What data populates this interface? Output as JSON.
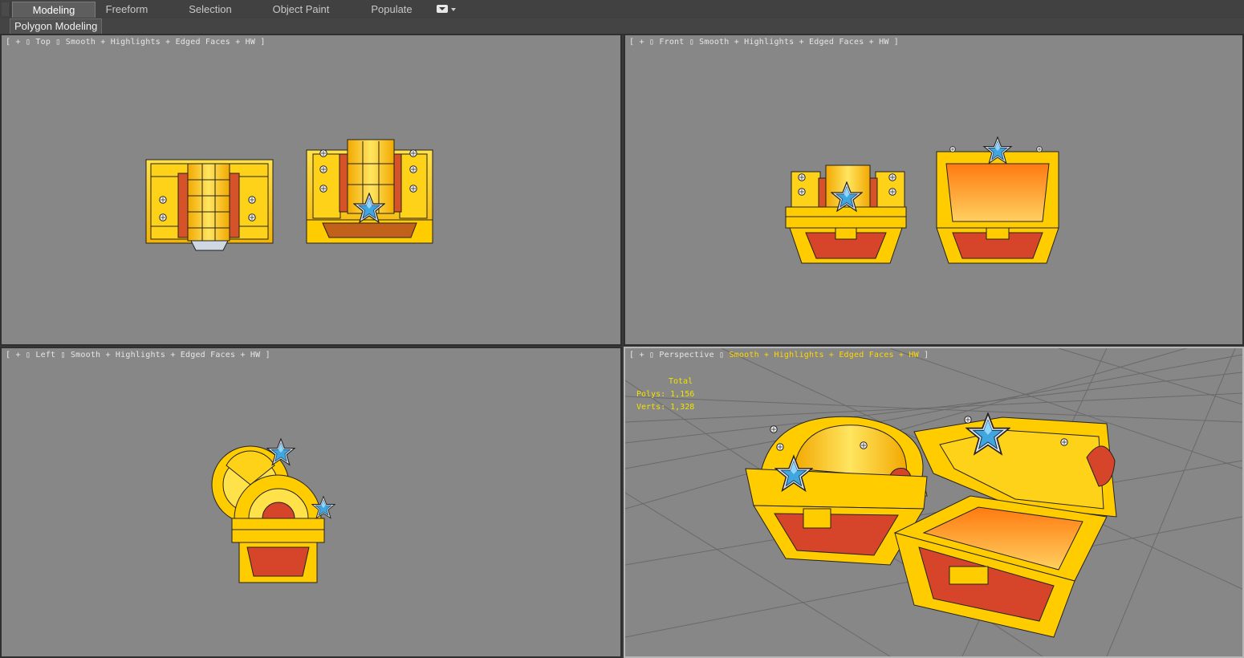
{
  "ribbon": {
    "tabs": [
      {
        "label": "Modeling",
        "active": true
      },
      {
        "label": "Freeform",
        "active": false
      },
      {
        "label": "Selection",
        "active": false
      },
      {
        "label": "Object Paint",
        "active": false
      },
      {
        "label": "Populate",
        "active": false
      }
    ],
    "panel_label": "Polygon Modeling"
  },
  "viewports": {
    "top": {
      "bracket_open": "[",
      "plus": "+",
      "view": "Top",
      "shading": "Smooth + Highlights + Edged Faces + HW",
      "bracket_close": "]"
    },
    "front": {
      "bracket_open": "[",
      "plus": "+",
      "view": "Front",
      "shading": "Smooth + Highlights + Edged Faces + HW",
      "bracket_close": "]"
    },
    "left": {
      "bracket_open": "[",
      "plus": "+",
      "view": "Left",
      "shading": "Smooth + Highlights + Edged Faces + HW",
      "bracket_close": "]"
    },
    "perspective": {
      "bracket_open": "[",
      "plus": "+",
      "view": "Perspective",
      "shading": "Smooth + Highlights + Edged Faces + HW",
      "bracket_close": "]",
      "active": true
    }
  },
  "stats": {
    "title": "Total",
    "polys": "Polys: 1,156",
    "verts": "Verts: 1,328"
  },
  "colors": {
    "viewport_bg": "#878787",
    "chest_gold": "#ffcc00",
    "chest_gold_light": "#ffe14a",
    "chest_red": "#d9452a",
    "gem_blue": "#4ab0e6",
    "stats_yellow": "#f2e200",
    "active_viewport_border": "#b7b7b7"
  },
  "icons": [
    "dropdown-toggle-icon",
    "dropdown-arrow-icon"
  ]
}
